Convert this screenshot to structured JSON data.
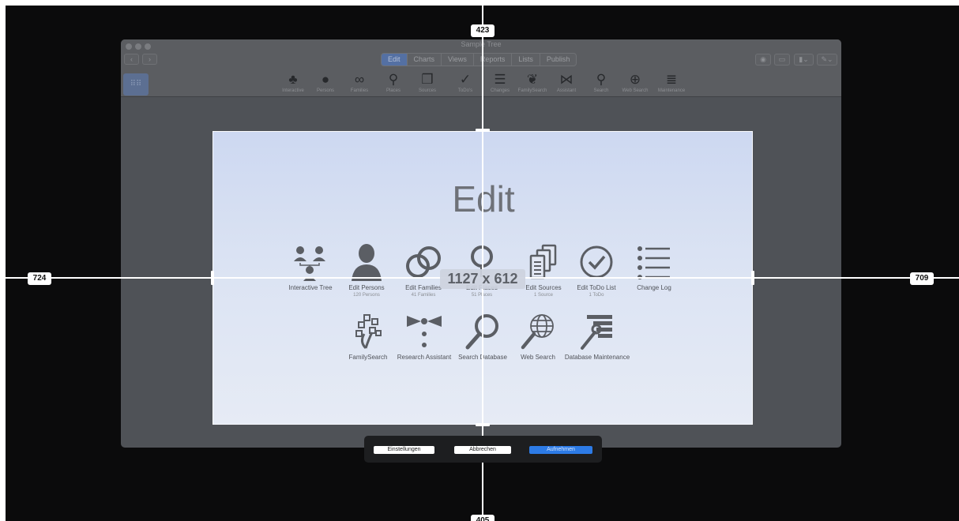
{
  "app": {
    "title": "Sample Tree",
    "tabs": [
      {
        "label": "Edit",
        "active": true
      },
      {
        "label": "Charts",
        "active": false
      },
      {
        "label": "Views",
        "active": false
      },
      {
        "label": "Reports",
        "active": false
      },
      {
        "label": "Lists",
        "active": false
      },
      {
        "label": "Publish",
        "active": false
      }
    ],
    "toolbar": [
      {
        "label": "Interactive",
        "icon": "interactive-tree-icon"
      },
      {
        "label": "Persons",
        "icon": "person-icon"
      },
      {
        "label": "Families",
        "icon": "rings-icon"
      },
      {
        "label": "Places",
        "icon": "pin-icon"
      },
      {
        "label": "Sources",
        "icon": "documents-icon"
      },
      {
        "label": "ToDo's",
        "icon": "checkmark-icon"
      },
      {
        "label": "Changes",
        "icon": "list-icon"
      },
      {
        "label": "FamilySearch",
        "icon": "familysearch-tree-icon"
      },
      {
        "label": "Assistant",
        "icon": "bowtie-icon"
      },
      {
        "label": "Search",
        "icon": "magnifier-icon"
      },
      {
        "label": "Web Search",
        "icon": "globe-search-icon"
      },
      {
        "label": "Maintenance",
        "icon": "maintenance-icon"
      }
    ]
  },
  "edit_panel": {
    "title": "Edit",
    "row1": [
      {
        "label": "Interactive Tree",
        "sub": "",
        "icon": "interactive-tree-icon"
      },
      {
        "label": "Edit Persons",
        "sub": "120 Persons",
        "icon": "person-icon"
      },
      {
        "label": "Edit Families",
        "sub": "41 Families",
        "icon": "rings-icon"
      },
      {
        "label": "Edit Places",
        "sub": "51 Places",
        "icon": "pin-icon"
      },
      {
        "label": "Edit Sources",
        "sub": "1 Source",
        "icon": "documents-icon"
      },
      {
        "label": "Edit ToDo List",
        "sub": "1 ToDo",
        "icon": "checkmark-icon"
      },
      {
        "label": "Change Log",
        "sub": "",
        "icon": "list-icon"
      }
    ],
    "row2": [
      {
        "label": "FamilySearch",
        "icon": "familysearch-tree-icon"
      },
      {
        "label": "Research Assistant",
        "icon": "bowtie-icon"
      },
      {
        "label": "Search Database",
        "icon": "magnifier-icon"
      },
      {
        "label": "Web Search",
        "icon": "globe-search-icon"
      },
      {
        "label": "Database Maintenance",
        "icon": "maintenance-icon"
      }
    ]
  },
  "capture": {
    "width": 1127,
    "height": 612,
    "size_label": "1127 x 612",
    "dist_top": "423",
    "dist_left": "724",
    "dist_right": "709",
    "dist_bottom": "405",
    "buttons": {
      "settings": "Einstellungen",
      "cancel": "Abbrechen",
      "record": "Aufnehmen"
    },
    "accent_color": "#2d7be6"
  }
}
